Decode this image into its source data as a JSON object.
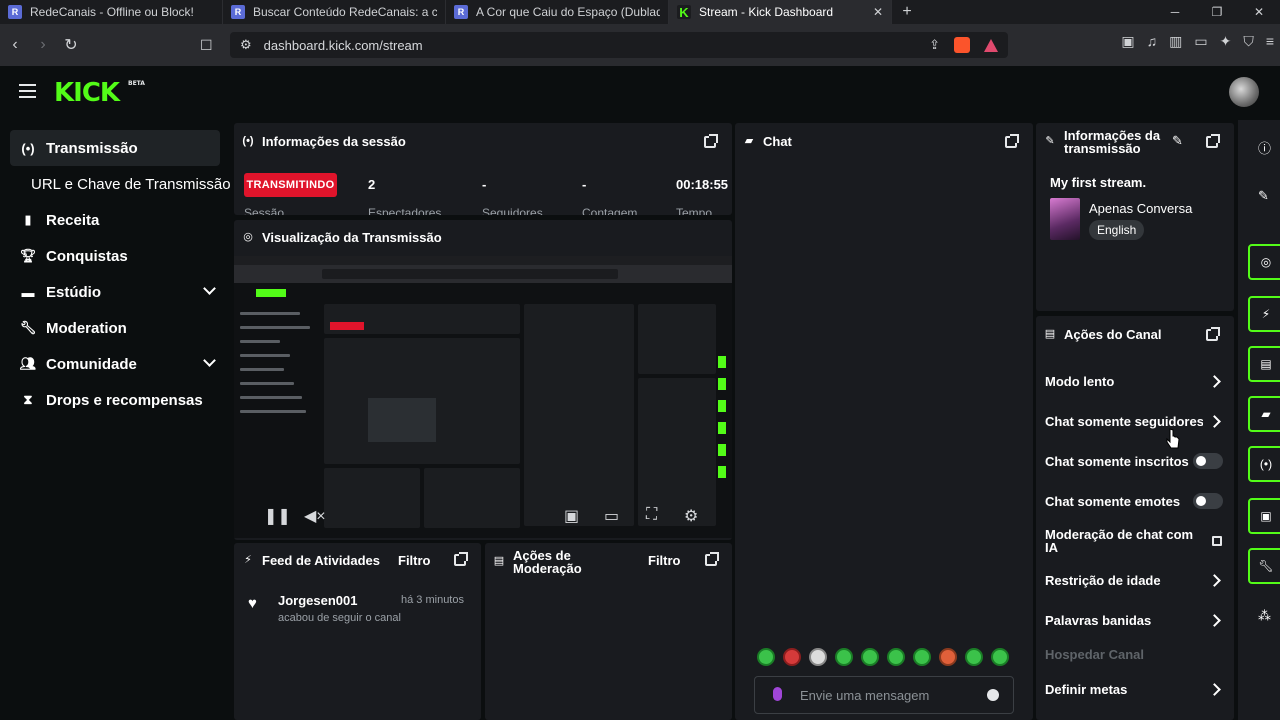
{
  "browser": {
    "tabs": [
      {
        "title": "RedeCanais - Offline ou Block!",
        "icon": "favicon-redecanais"
      },
      {
        "title": "Buscar Conteúdo RedeCanais: a cor c",
        "icon": "favicon-redecanais"
      },
      {
        "title": "A Cor que Caiu do Espaço (Dublado)",
        "icon": "favicon-redecanais"
      },
      {
        "title": "Stream - Kick Dashboard",
        "icon": "favicon-kick",
        "active": true
      }
    ],
    "url": "dashboard.kick.com/stream"
  },
  "app": {
    "logo": "KICK",
    "logo_badge": "BETA"
  },
  "sidebar": {
    "items": [
      {
        "label": "Transmissão",
        "icon": "broadcast-icon",
        "active": true
      },
      {
        "label": "URL e Chave de Transmissão",
        "sub": true
      },
      {
        "label": "Receita",
        "icon": "chart-icon"
      },
      {
        "label": "Conquistas",
        "icon": "trophy-icon"
      },
      {
        "label": "Estúdio",
        "icon": "studio-icon",
        "expandable": true
      },
      {
        "label": "Moderation",
        "icon": "wrench-icon"
      },
      {
        "label": "Comunidade",
        "icon": "community-icon",
        "expandable": true
      },
      {
        "label": "Drops e recompensas",
        "icon": "drops-icon"
      }
    ]
  },
  "session": {
    "title": "Informações da sessão",
    "status": "TRANSMITINDO",
    "status_label": "Sessão",
    "stats": [
      {
        "value": "2",
        "label": "Espectadores"
      },
      {
        "value": "-",
        "label": "Seguidores"
      },
      {
        "value": "-",
        "label": "Contagem"
      },
      {
        "value": "00:18:55",
        "label": "Tempo"
      }
    ]
  },
  "preview": {
    "title": "Visualização da Transmissão"
  },
  "chat": {
    "title": "Chat",
    "placeholder": "Envie uma mensagem",
    "emotes": [
      "emote-1",
      "emote-2",
      "emote-3",
      "emote-4",
      "emote-5",
      "emote-6",
      "emote-7",
      "emote-8",
      "emote-9",
      "emote-10"
    ]
  },
  "broadcast_info": {
    "title": "Informações da transmissão",
    "stream_title": "My first stream.",
    "category": "Apenas Conversa",
    "language": "English"
  },
  "activity": {
    "title": "Feed de Atividades",
    "filter": "Filtro",
    "items": [
      {
        "user": "Jorgesen001",
        "time": "há 3 minutos",
        "text": "acabou de seguir o canal"
      }
    ]
  },
  "moderation": {
    "title": "Ações de Moderação",
    "filter": "Filtro"
  },
  "channel_actions": {
    "title": "Ações do Canal",
    "items": [
      {
        "label": "Modo lento",
        "control": "chevron"
      },
      {
        "label": "Chat somente seguidores",
        "control": "chevron"
      },
      {
        "label": "Chat somente inscritos",
        "control": "toggle",
        "on": false
      },
      {
        "label": "Chat somente emotes",
        "control": "toggle",
        "on": false
      },
      {
        "label": "Moderação de chat com IA",
        "control": "external"
      },
      {
        "label": "Restrição de idade",
        "control": "chevron"
      },
      {
        "label": "Palavras banidas",
        "control": "chevron"
      },
      {
        "label": "Hospedar Canal",
        "control": "none",
        "disabled": true
      },
      {
        "label": "Definir metas",
        "control": "chevron"
      }
    ]
  },
  "colors": {
    "brand": "#53fc18",
    "live": "#e0142b",
    "panel": "#191b1f"
  }
}
